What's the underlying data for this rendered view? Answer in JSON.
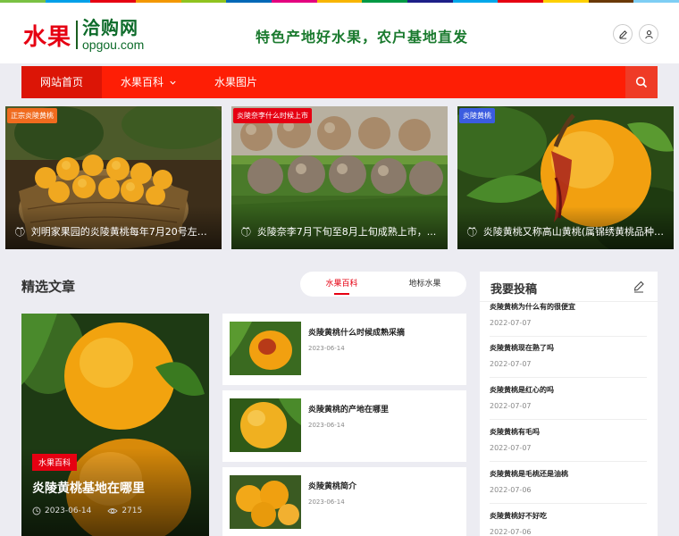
{
  "colors": {
    "accent": "#fe1e05",
    "brand_red": "#e60012",
    "brand_green": "#1a7a2e",
    "rainbow": [
      "#7ac143",
      "#00a0e9",
      "#e60012",
      "#f39800",
      "#8fc31f",
      "#0068b7",
      "#e4007f",
      "#f8b500",
      "#009944",
      "#1d2088",
      "#00a7ea",
      "#e60012",
      "#fdd000",
      "#6a3906",
      "#7ecef4"
    ]
  },
  "header": {
    "logo_cn": "水果",
    "logo_name": "洽购网",
    "logo_domain": "opgou.com",
    "slogan": "特色产地好水果，农户基地直发",
    "edit_icon": "edit-icon",
    "user_icon": "user-icon"
  },
  "nav": {
    "items": [
      {
        "label": "网站首页",
        "active": true
      },
      {
        "label": "水果百科",
        "dropdown": true
      },
      {
        "label": "水果图片"
      }
    ],
    "search_icon": "search-icon"
  },
  "heroes": [
    {
      "tag": "正宗炎陵黄桃",
      "tag_color": "#f06b1e",
      "caption": "刘明家果园的炎陵黄桃每年7月20号左右..."
    },
    {
      "tag": "炎陵奈李什么时候上市",
      "tag_color": "#e60012",
      "caption": "炎陵奈李7月下旬至8月上旬成熟上市，..."
    },
    {
      "tag": "炎陵黄桃",
      "tag_color": "#3b5ce0",
      "caption": "炎陵黄桃又称高山黄桃(属锦绣黄桃品种)..."
    }
  ],
  "featured": {
    "section_title": "精选文章",
    "tabs": [
      "水果百科",
      "地标水果"
    ],
    "active_tab": 0,
    "main": {
      "badge": "水果百科",
      "title": "炎陵黄桃基地在哪里",
      "date": "2023-06-14",
      "views": "2715"
    },
    "posts": [
      {
        "title": "炎陵黄桃什么时候成熟采摘",
        "date": "2023-06-14"
      },
      {
        "title": "炎陵黄桃的产地在哪里",
        "date": "2023-06-14"
      },
      {
        "title": "炎陵黄桃简介",
        "date": "2023-06-14"
      }
    ]
  },
  "sidebar": {
    "title": "我要投稿",
    "items": [
      {
        "title": "炎陵黄桃为什么有的很便宜",
        "date": "2022-07-07"
      },
      {
        "title": "炎陵黄桃现在熟了吗",
        "date": "2022-07-07"
      },
      {
        "title": "炎陵黄桃是红心的吗",
        "date": "2022-07-07"
      },
      {
        "title": "炎陵黄桃有毛吗",
        "date": "2022-07-07"
      },
      {
        "title": "炎陵黄桃是毛桃还是油桃",
        "date": "2022-07-06"
      },
      {
        "title": "炎陵黄桃好不好吃",
        "date": "2022-07-06"
      }
    ]
  }
}
